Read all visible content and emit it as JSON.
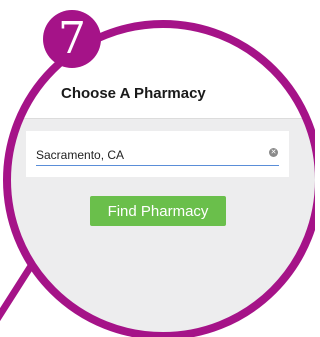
{
  "step": {
    "number": "7"
  },
  "header": {
    "back_icon": "arrow-left-icon",
    "title": "Choose A Pharmacy"
  },
  "search": {
    "value": "Sacramento, CA",
    "clear_icon": "clear-circle-icon"
  },
  "actions": {
    "find_label": "Find Pharmacy"
  },
  "colors": {
    "accent": "#a51388",
    "button": "#6abf4b",
    "input_underline": "#5a8ed8",
    "background": "#ededee"
  }
}
